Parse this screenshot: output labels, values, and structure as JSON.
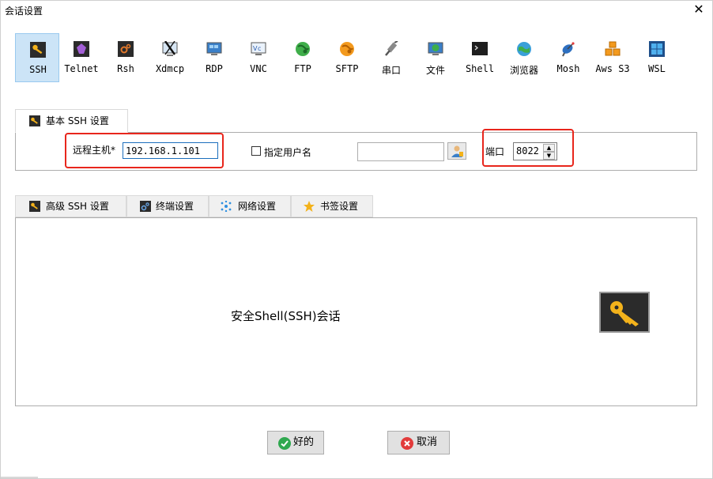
{
  "window": {
    "title": "会话设置",
    "close_symbol": "✕"
  },
  "protocols": [
    {
      "label": "SSH",
      "icon": "ssh-key-icon",
      "selected": true
    },
    {
      "label": "Telnet",
      "icon": "telnet-icon"
    },
    {
      "label": "Rsh",
      "icon": "rsh-icon"
    },
    {
      "label": "Xdmcp",
      "icon": "xdmcp-icon"
    },
    {
      "label": "RDP",
      "icon": "rdp-monitor-icon"
    },
    {
      "label": "VNC",
      "icon": "vnc-monitor-icon"
    },
    {
      "label": "FTP",
      "icon": "ftp-globe-icon"
    },
    {
      "label": "SFTP",
      "icon": "sftp-globe-icon"
    },
    {
      "label": "串口",
      "icon": "serial-plug-icon"
    },
    {
      "label": "文件",
      "icon": "file-monitor-icon"
    },
    {
      "label": "Shell",
      "icon": "shell-terminal-icon"
    },
    {
      "label": "浏览器",
      "icon": "browser-globe-icon"
    },
    {
      "label": "Mosh",
      "icon": "mosh-satellite-icon"
    },
    {
      "label": "Aws S3",
      "icon": "aws-cubes-icon"
    },
    {
      "label": "WSL",
      "icon": "wsl-windows-icon"
    }
  ],
  "basic_tab": {
    "label": "基本 SSH 设置",
    "remote_host_label": "远程主机*",
    "remote_host_value": "192.168.1.101",
    "specify_user_label": "指定用户名",
    "username_value": "",
    "port_label": "端口",
    "port_value": "8022"
  },
  "lower_tabs": [
    {
      "label": "高级 SSH 设置",
      "icon": "ssh-key-icon"
    },
    {
      "label": "终端设置",
      "icon": "terminal-settings-icon"
    },
    {
      "label": "网络设置",
      "icon": "network-icon"
    },
    {
      "label": "书签设置",
      "icon": "bookmark-star-icon"
    }
  ],
  "description": "安全Shell(SSH)会话",
  "buttons": {
    "ok": "好的",
    "cancel": "取消"
  },
  "colors": {
    "selected_bg": "#cce4f7",
    "highlight_red": "#e8261c",
    "ok_green": "#2fa84f",
    "cancel_red": "#e23b3b",
    "key_gold": "#f3b21b"
  }
}
